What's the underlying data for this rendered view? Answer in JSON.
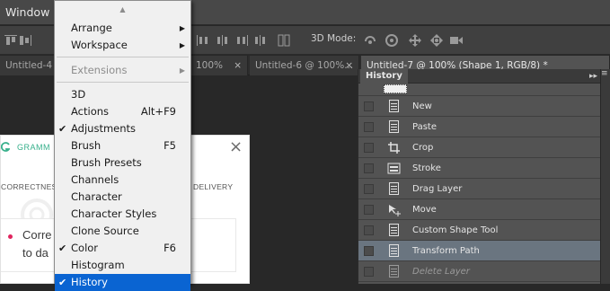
{
  "menubar": {
    "window_label": "Window"
  },
  "options_bar": {
    "mode_3d_label": "3D Mode:",
    "icons": [
      "align-left-icon",
      "align-center-icon",
      "distribute-icon",
      "3d-rotate-icon",
      "3d-roll-icon",
      "3d-pan-icon",
      "3d-slide-icon",
      "3d-scale-icon"
    ]
  },
  "tabs": [
    {
      "label": "Untitled-4",
      "active": false
    },
    {
      "label": "100%",
      "active": false
    },
    {
      "label": "Untitled-6 @ 100%...",
      "active": false
    },
    {
      "label": "Untitled-7 @ 100% (Shape 1, RGB/8) *",
      "active": true
    }
  ],
  "dropdown": {
    "items": [
      {
        "label": "Arrange",
        "submenu": true
      },
      {
        "label": "Workspace",
        "submenu": true
      },
      {
        "label": "Extensions",
        "submenu": true,
        "disabled": true
      },
      {
        "label": "3D"
      },
      {
        "label": "Actions",
        "shortcut": "Alt+F9"
      },
      {
        "label": "Adjustments",
        "checked": true
      },
      {
        "label": "Brush",
        "shortcut": "F5"
      },
      {
        "label": "Brush Presets"
      },
      {
        "label": "Channels"
      },
      {
        "label": "Character"
      },
      {
        "label": "Character Styles"
      },
      {
        "label": "Clone Source"
      },
      {
        "label": "Color",
        "checked": true,
        "shortcut": "F6"
      },
      {
        "label": "Histogram"
      },
      {
        "label": "History",
        "checked": true,
        "highlighted": true
      }
    ]
  },
  "history_panel": {
    "title": "History",
    "items": [
      {
        "label": "New",
        "icon": "document-icon"
      },
      {
        "label": "Paste",
        "icon": "document-icon"
      },
      {
        "label": "Crop",
        "icon": "crop-icon"
      },
      {
        "label": "Stroke",
        "icon": "stroke-icon"
      },
      {
        "label": "Drag Layer",
        "icon": "document-icon"
      },
      {
        "label": "Move",
        "icon": "move-icon"
      },
      {
        "label": "Custom Shape Tool",
        "icon": "document-icon"
      },
      {
        "label": "Transform Path",
        "icon": "document-icon",
        "selected": true
      },
      {
        "label": "Delete Layer",
        "icon": "document-icon",
        "undone": true
      }
    ]
  },
  "grammarly": {
    "brand": "GRAMM",
    "correctness": "CORRECTNESS",
    "delivery": "DELIVERY",
    "line1": "Corre",
    "line2": "to da"
  },
  "colors": {
    "menu_highlight": "#0a64d2",
    "history_selected": "#6a7580",
    "grammarly_green": "#37b08b"
  }
}
